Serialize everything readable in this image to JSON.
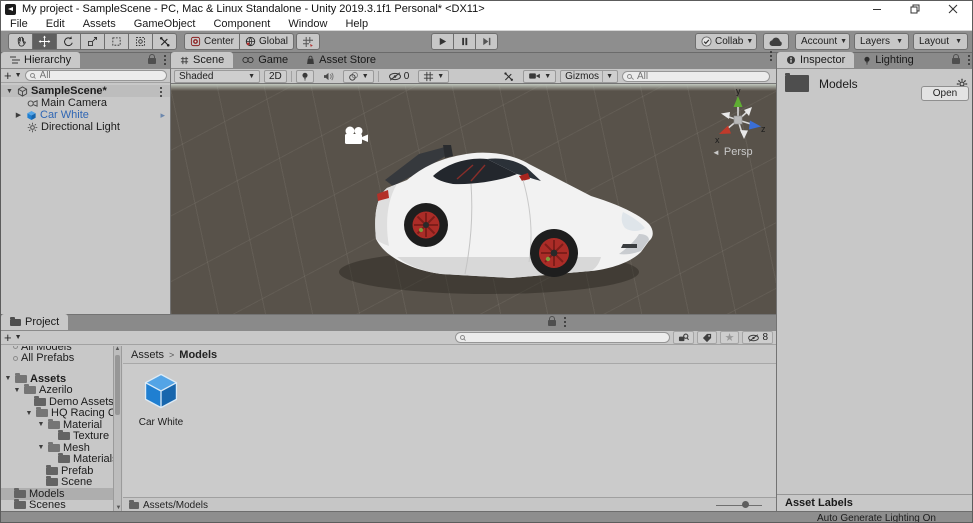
{
  "window": {
    "title": "My project - SampleScene - PC, Mac & Linux Standalone - Unity 2019.3.1f1 Personal* <DX11>"
  },
  "menu": {
    "items": [
      "File",
      "Edit",
      "Assets",
      "GameObject",
      "Component",
      "Window",
      "Help"
    ]
  },
  "toolbar": {
    "pivot_label": "Center",
    "space_label": "Global",
    "collab_label": "Collab",
    "account_label": "Account",
    "layers_label": "Layers",
    "layout_label": "Layout"
  },
  "hierarchy": {
    "tab_label": "Hierarchy",
    "search_placeholder": "All",
    "scene_name": "SampleScene*",
    "items": [
      {
        "label": "Main Camera"
      },
      {
        "label": "Car White"
      },
      {
        "label": "Directional Light"
      }
    ]
  },
  "scene_view": {
    "tabs": [
      "Scene",
      "Game",
      "Asset Store"
    ],
    "shading_mode": "Shaded",
    "mode_2d_label": "2D",
    "hidden_count": "0",
    "gizmos_label": "Gizmos",
    "search_placeholder": "All",
    "axis": {
      "x": "x",
      "y": "y",
      "z": "z"
    },
    "projection_label": "Persp"
  },
  "inspector": {
    "tabs": [
      "Inspector",
      "Lighting"
    ],
    "title": "Models",
    "open_button": "Open",
    "asset_labels_header": "Asset Labels"
  },
  "project": {
    "tab_label": "Project",
    "search_placeholder": "",
    "favorites": [
      {
        "label": "All Models"
      },
      {
        "label": "All Prefabs"
      }
    ],
    "tree": [
      {
        "label": "Assets"
      },
      {
        "label": "Azerilo"
      },
      {
        "label": "Demo Assets"
      },
      {
        "label": "HQ Racing Car"
      },
      {
        "label": "Material"
      },
      {
        "label": "Texture"
      },
      {
        "label": "Mesh"
      },
      {
        "label": "Materials"
      },
      {
        "label": "Prefab"
      },
      {
        "label": "Scene"
      },
      {
        "label": "Models"
      },
      {
        "label": "Scenes"
      }
    ],
    "breadcrumb": [
      "Assets",
      "Models"
    ],
    "items": [
      {
        "label": "Car White"
      }
    ],
    "path_bar": "Assets/Models",
    "hidden_count": "8"
  },
  "status_bar": {
    "right": "Auto Generate Lighting On"
  },
  "colors": {
    "selection_blue": "#2f66b4",
    "asset_blue": "#1f7fd1",
    "wheel_red": "#ab2c27",
    "viewport_brown": "#58524a"
  }
}
